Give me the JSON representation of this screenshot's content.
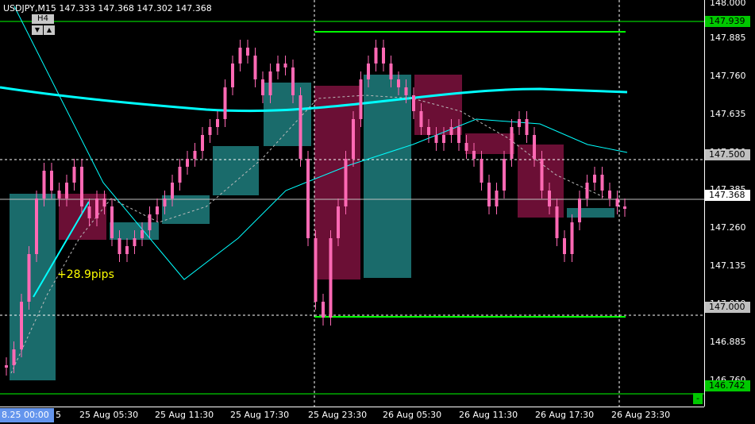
{
  "header": {
    "symbol_line": "USDJPY,M15  147.333 147.368 147.302 147.368",
    "timeframe_label": "H4",
    "down_icon": "▼",
    "up_icon": "▲"
  },
  "annotations": {
    "pips": "+28.9pips"
  },
  "price_axis": {
    "ticks": [
      "148.000",
      "147.885",
      "147.760",
      "147.635",
      "147.510",
      "147.385",
      "147.260",
      "147.135",
      "147.010",
      "146.885",
      "146.760"
    ],
    "tags": [
      {
        "id": "level_top",
        "label": "147.939",
        "bg": "#00c800",
        "fg": "#000000"
      },
      {
        "id": "level_mid",
        "label": "147.500",
        "bg": "#c0c0c0",
        "fg": "#000000"
      },
      {
        "id": "bid",
        "label": "147.368",
        "bg": "#ffffff",
        "fg": "#000000"
      },
      {
        "id": "level_low",
        "label": "147.000",
        "bg": "#c0c0c0",
        "fg": "#000000"
      },
      {
        "id": "level_bottom",
        "label": "146.742",
        "bg": "#00c800",
        "fg": "#000000"
      }
    ]
  },
  "time_axis": {
    "corner_label": "8.25 00:00",
    "corner_suffix": "5",
    "labels": [
      "25 Aug 05:30",
      "25 Aug 11:30",
      "25 Aug 17:30",
      "25 Aug 23:30",
      "26 Aug 05:30",
      "26 Aug 11:30",
      "26 Aug 17:30",
      "26 Aug 23:30"
    ]
  },
  "chart_data": {
    "type": "candlestick",
    "symbol": "USDJPY",
    "timeframe": "M15",
    "ohlc_current": {
      "open": 147.333,
      "high": 147.368,
      "low": 147.302,
      "close": 147.368
    },
    "ylim": [
      146.72,
      148.0
    ],
    "horizontal_levels": [
      147.939,
      147.5,
      147.368,
      147.0,
      146.742
    ],
    "colors": {
      "bull": "#ff69b4",
      "bear": "#ff69b4",
      "h4_bull": "#1a6b6b",
      "h4_bear": "#6b0f35",
      "ma": "#00ffff",
      "level": "#00ff00"
    }
  },
  "buttons": {
    "minus": "-"
  }
}
